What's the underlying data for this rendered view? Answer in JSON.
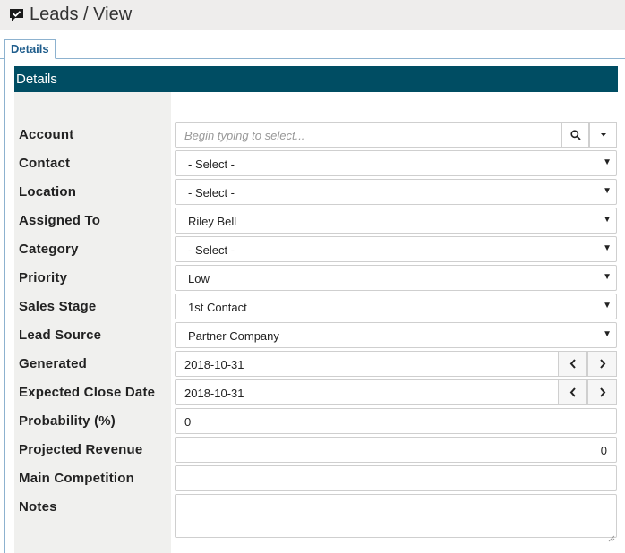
{
  "header": {
    "title": "Leads / View",
    "icon": "comment-check-icon"
  },
  "tabs": [
    {
      "label": "Details",
      "active": true
    }
  ],
  "section": {
    "title": "Details"
  },
  "form": {
    "account": {
      "label": "Account",
      "placeholder": "Begin typing to select..."
    },
    "contact": {
      "label": "Contact",
      "value": "- Select -"
    },
    "location": {
      "label": "Location",
      "value": "- Select -"
    },
    "assigned_to": {
      "label": "Assigned To",
      "value": "Riley Bell"
    },
    "category": {
      "label": "Category",
      "value": "- Select -"
    },
    "priority": {
      "label": "Priority",
      "value": "Low"
    },
    "sales_stage": {
      "label": "Sales Stage",
      "value": "1st Contact"
    },
    "lead_source": {
      "label": "Lead Source",
      "value": "Partner Company"
    },
    "generated": {
      "label": "Generated",
      "value": "2018-10-31"
    },
    "expected_close_date": {
      "label": "Expected Close Date",
      "value": "2018-10-31"
    },
    "probability": {
      "label": "Probability (%)",
      "value": "0"
    },
    "projected_revenue": {
      "label": "Projected Revenue",
      "value": "0"
    },
    "main_competition": {
      "label": "Main Competition",
      "value": ""
    },
    "notes": {
      "label": "Notes",
      "value": ""
    }
  },
  "colors": {
    "header_bg": "#004d63",
    "tab_text": "#1f5d8c",
    "label_col_bg": "#f0f0ee",
    "titlebar_bg": "#eeedec"
  }
}
